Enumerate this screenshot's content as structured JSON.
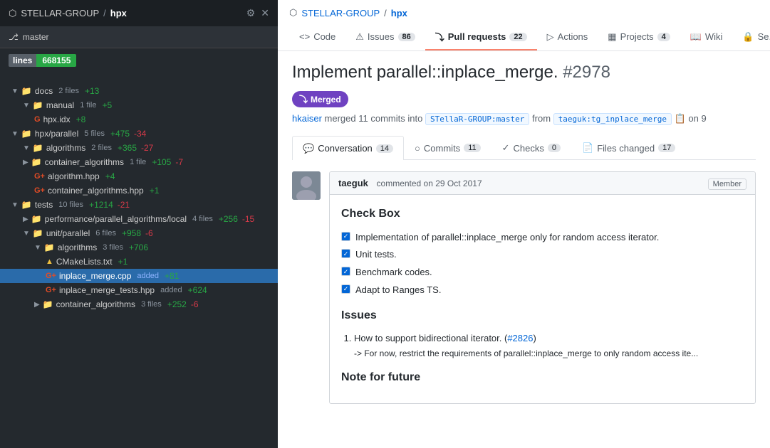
{
  "sidebar": {
    "header": {
      "org": "STELLAR-GROUP",
      "repo": "hpx",
      "separator": "/",
      "branch": "master"
    },
    "lines_badge": {
      "label": "lines",
      "value": "668155"
    },
    "tree": [
      {
        "id": "docs",
        "indent": 0,
        "type": "folder",
        "name": "docs",
        "count": "2 files",
        "added": "+13",
        "removed": ""
      },
      {
        "id": "manual",
        "indent": 1,
        "type": "folder",
        "name": "manual",
        "count": "1 file",
        "added": "+5",
        "removed": ""
      },
      {
        "id": "hpx-idx",
        "indent": 2,
        "type": "file-g",
        "name": "hpx.idx",
        "count": "",
        "added": "+8",
        "removed": ""
      },
      {
        "id": "hpx-parallel",
        "indent": 0,
        "type": "folder",
        "name": "hpx/parallel",
        "count": "5 files",
        "added": "+475",
        "removed": "-34"
      },
      {
        "id": "algorithms-1",
        "indent": 1,
        "type": "folder",
        "name": "algorithms",
        "count": "2 files",
        "added": "+365",
        "removed": "-27"
      },
      {
        "id": "container_algorithms-1",
        "indent": 1,
        "type": "folder",
        "name": "container_algorithms",
        "count": "1 file",
        "added": "+105",
        "removed": "-7"
      },
      {
        "id": "algorithm-hpp",
        "indent": 2,
        "type": "file-g",
        "name": "algorithm.hpp",
        "count": "",
        "added": "+4",
        "removed": ""
      },
      {
        "id": "container_algorithms-hpp",
        "indent": 2,
        "type": "file-g",
        "name": "container_algorithms.hpp",
        "count": "",
        "added": "+1",
        "removed": ""
      },
      {
        "id": "tests",
        "indent": 0,
        "type": "folder",
        "name": "tests",
        "count": "10 files",
        "added": "+1214",
        "removed": "-21"
      },
      {
        "id": "perf-parallel",
        "indent": 1,
        "type": "folder",
        "name": "performance/parallel_algorithms/local",
        "count": "4 files",
        "added": "+256",
        "removed": "-15"
      },
      {
        "id": "unit-parallel",
        "indent": 1,
        "type": "folder",
        "name": "unit/parallel",
        "count": "6 files",
        "added": "+958",
        "removed": "-6"
      },
      {
        "id": "algorithms-2",
        "indent": 2,
        "type": "folder",
        "name": "algorithms",
        "count": "3 files",
        "added": "+706",
        "removed": ""
      },
      {
        "id": "cmakelists",
        "indent": 3,
        "type": "file-cmake",
        "name": "CMakeLists.txt",
        "count": "",
        "added": "+1",
        "removed": ""
      },
      {
        "id": "inplace-merge-cpp",
        "indent": 3,
        "type": "file-g",
        "name": "inplace_merge.cpp",
        "added_label": "added",
        "added": "+81",
        "removed": "",
        "active": true
      },
      {
        "id": "inplace-merge-tests",
        "indent": 3,
        "type": "file-g",
        "name": "inplace_merge_tests.hpp",
        "added_label": "added",
        "added": "+624",
        "removed": ""
      },
      {
        "id": "container_algorithms-2",
        "indent": 2,
        "type": "folder",
        "name": "container_algorithms",
        "count": "3 files",
        "added": "+252",
        "removed": "-6"
      }
    ]
  },
  "main": {
    "repo_path": {
      "org": "STELLAR-GROUP",
      "sep": "/",
      "repo": "hpx"
    },
    "nav_tabs": [
      {
        "id": "code",
        "icon": "<>",
        "label": "Code",
        "count": ""
      },
      {
        "id": "issues",
        "label": "Issues",
        "count": "86"
      },
      {
        "id": "pull-requests",
        "label": "Pull requests",
        "count": "22",
        "active": true
      },
      {
        "id": "actions",
        "label": "Actions",
        "count": ""
      },
      {
        "id": "projects",
        "label": "Projects",
        "count": "4"
      },
      {
        "id": "wiki",
        "label": "Wiki",
        "count": ""
      },
      {
        "id": "security",
        "label": "Se...",
        "count": ""
      }
    ],
    "pr": {
      "title": "Implement parallel::inplace_merge.",
      "number": "#2978",
      "status": "Merged",
      "author": "hkaiser",
      "commits_count": "11",
      "base_branch": "STellaR-GROUP:master",
      "head_branch": "taeguk:tg_inplace_merge",
      "date_text": "on 9"
    },
    "sub_tabs": [
      {
        "id": "conversation",
        "label": "Conversation",
        "count": "14",
        "active": true
      },
      {
        "id": "commits",
        "label": "Commits",
        "count": "11"
      },
      {
        "id": "checks",
        "label": "Checks",
        "count": "0"
      },
      {
        "id": "files-changed",
        "label": "Files changed",
        "count": "17"
      }
    ],
    "comment": {
      "avatar_text": "👤",
      "author": "taeguk",
      "date": "commented on 29 Oct 2017",
      "member_label": "Member",
      "body": {
        "section1_title": "Check Box",
        "checklist": [
          "Implementation of parallel::inplace_merge only for random access iterator.",
          "Unit tests.",
          "Benchmark codes.",
          "Adapt to Ranges TS."
        ],
        "section2_title": "Issues",
        "issues": [
          {
            "text": "How to support bidirectional iterator. (#2826)",
            "link_text": "#2826",
            "sub": "-> For now, restrict the requirements of parallel::inplace_merge to only random access ite..."
          }
        ],
        "section3_title": "Note for future"
      }
    }
  }
}
